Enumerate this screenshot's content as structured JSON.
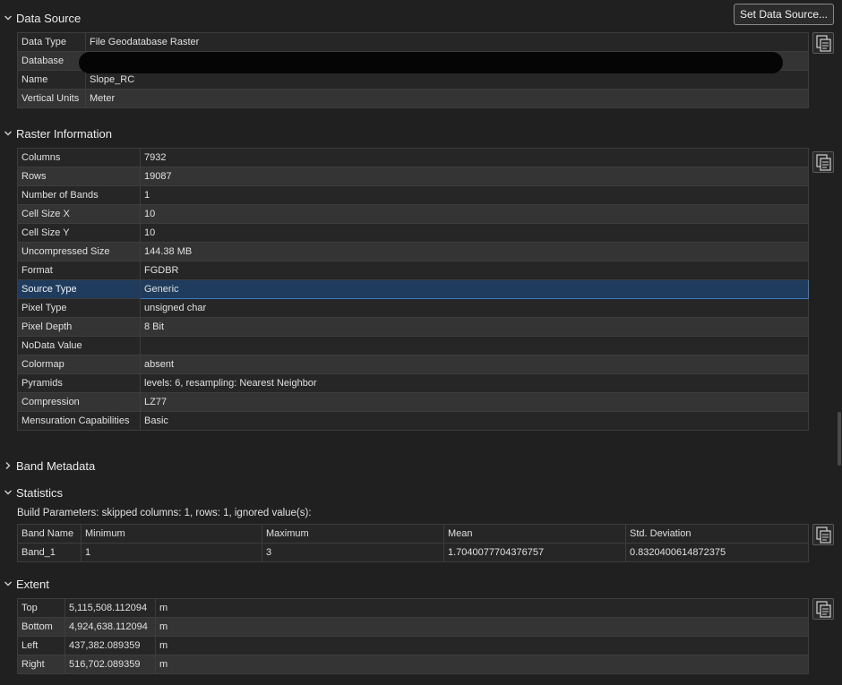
{
  "data_source": {
    "title": "Data Source",
    "set_button": "Set Data Source...",
    "rows": [
      {
        "key": "Data Type",
        "value": "File Geodatabase Raster"
      },
      {
        "key": "Database",
        "value": ""
      },
      {
        "key": "Name",
        "value": "Slope_RC"
      },
      {
        "key": "Vertical Units",
        "value": "Meter"
      }
    ]
  },
  "raster_info": {
    "title": "Raster Information",
    "rows": [
      {
        "key": "Columns",
        "value": "7932"
      },
      {
        "key": "Rows",
        "value": "19087"
      },
      {
        "key": "Number of Bands",
        "value": "1"
      },
      {
        "key": "Cell Size X",
        "value": "10"
      },
      {
        "key": "Cell Size Y",
        "value": "10"
      },
      {
        "key": "Uncompressed Size",
        "value": "144.38 MB"
      },
      {
        "key": "Format",
        "value": "FGDBR"
      },
      {
        "key": "Source Type",
        "value": "Generic"
      },
      {
        "key": "Pixel Type",
        "value": "unsigned char"
      },
      {
        "key": "Pixel Depth",
        "value": "8 Bit"
      },
      {
        "key": "NoData Value",
        "value": ""
      },
      {
        "key": "Colormap",
        "value": "absent"
      },
      {
        "key": "Pyramids",
        "value": "levels: 6, resampling: Nearest Neighbor"
      },
      {
        "key": "Compression",
        "value": "LZ77"
      },
      {
        "key": "Mensuration Capabilities",
        "value": "Basic"
      }
    ]
  },
  "band_metadata": {
    "title": "Band Metadata"
  },
  "statistics": {
    "title": "Statistics",
    "build_params": "Build Parameters: skipped columns: 1, rows: 1, ignored value(s):",
    "headers": [
      "Band Name",
      "Minimum",
      "Maximum",
      "Mean",
      "Std. Deviation"
    ],
    "rows": [
      [
        "Band_1",
        "1",
        "3",
        "1.7040077704376757",
        "0.8320400614872375"
      ]
    ]
  },
  "extent": {
    "title": "Extent",
    "rows": [
      {
        "key": "Top",
        "value": "5,115,508.112094",
        "unit": "m"
      },
      {
        "key": "Bottom",
        "value": "4,924,638.112094",
        "unit": "m"
      },
      {
        "key": "Left",
        "value": "437,382.089359",
        "unit": "m"
      },
      {
        "key": "Right",
        "value": "516,702.089359",
        "unit": "m"
      }
    ]
  },
  "icons": {
    "expanded": "chevron-down-icon",
    "collapsed": "chevron-right-icon",
    "copy": "copy-to-clipboard-icon"
  },
  "colors": {
    "background": "#202020",
    "selection": "#1f3c5e",
    "selection_border": "#3d7ac4"
  }
}
